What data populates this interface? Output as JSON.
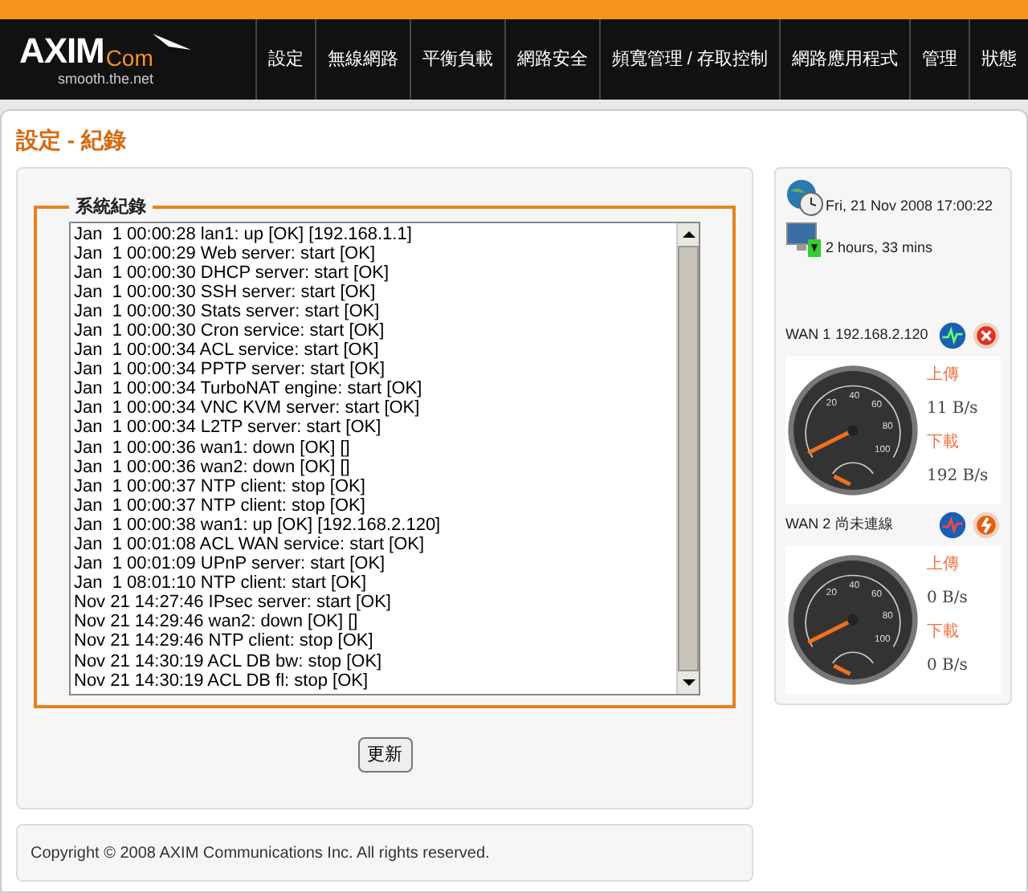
{
  "header": {
    "logo": {
      "brand": "AXIM",
      "suffix": "Com",
      "tagline": "smooth.the.net"
    },
    "nav": [
      {
        "label": "設定",
        "selected": false
      },
      {
        "label": "無線網路",
        "selected": false
      },
      {
        "label": "平衡負載",
        "selected": false
      },
      {
        "label": "網路安全",
        "selected": false
      },
      {
        "label": "頻寬管理 / 存取控制",
        "selected": false
      },
      {
        "label": "網路應用程式",
        "selected": false
      },
      {
        "label": "管理",
        "selected": false
      },
      {
        "label": "狀態",
        "selected": false
      }
    ]
  },
  "page_title": "設定 - 紀錄",
  "log": {
    "legend": "系統紀錄",
    "lines": [
      "Jan  1 00:00:28 lan1: up [OK] [192.168.1.1]",
      "Jan  1 00:00:29 Web server: start [OK]",
      "Jan  1 00:00:30 DHCP server: start [OK]",
      "Jan  1 00:00:30 SSH server: start [OK]",
      "Jan  1 00:00:30 Stats server: start [OK]",
      "Jan  1 00:00:30 Cron service: start [OK]",
      "Jan  1 00:00:34 ACL service: start [OK]",
      "Jan  1 00:00:34 PPTP server: start [OK]",
      "Jan  1 00:00:34 TurboNAT engine: start [OK]",
      "Jan  1 00:00:34 VNC KVM server: start [OK]",
      "Jan  1 00:00:34 L2TP server: start [OK]",
      "Jan  1 00:00:36 wan1: down [OK] []",
      "Jan  1 00:00:36 wan2: down [OK] []",
      "Jan  1 00:00:37 NTP client: stop [OK]",
      "Jan  1 00:00:37 NTP client: stop [OK]",
      "Jan  1 00:00:38 wan1: up [OK] [192.168.2.120]",
      "Jan  1 00:01:08 ACL WAN service: start [OK]",
      "Jan  1 00:01:09 UPnP server: start [OK]",
      "Jan  1 08:01:10 NTP client: start [OK]",
      "Nov 21 14:27:46 IPsec server: start [OK]",
      "Nov 21 14:29:46 wan2: down [OK] []",
      "Nov 21 14:29:46 NTP client: stop [OK]",
      "Nov 21 14:30:19 ACL DB bw: stop [OK]",
      "Nov 21 14:30:19 ACL DB fl: stop [OK]"
    ]
  },
  "refresh_button": "更新",
  "footer": "Copyright © 2008 AXIM Communications Inc. All rights reserved.",
  "status": {
    "datetime": "Fri, 21 Nov 2008 17:00:22",
    "uptime": "2 hours, 33 mins",
    "wans": [
      {
        "name": "WAN 1",
        "info": "192.168.2.120",
        "connected": true,
        "ticks": [
          "20",
          "40",
          "60",
          "80",
          "100"
        ],
        "upload_label": "上傳",
        "upload": "11 B/s",
        "download_label": "下載",
        "download": "192 B/s"
      },
      {
        "name": "WAN 2",
        "info": "尚未連線",
        "connected": false,
        "ticks": [
          "20",
          "40",
          "60",
          "80",
          "100"
        ],
        "upload_label": "上傳",
        "upload": "0 B/s",
        "download_label": "下載",
        "download": "0 B/s"
      }
    ]
  }
}
